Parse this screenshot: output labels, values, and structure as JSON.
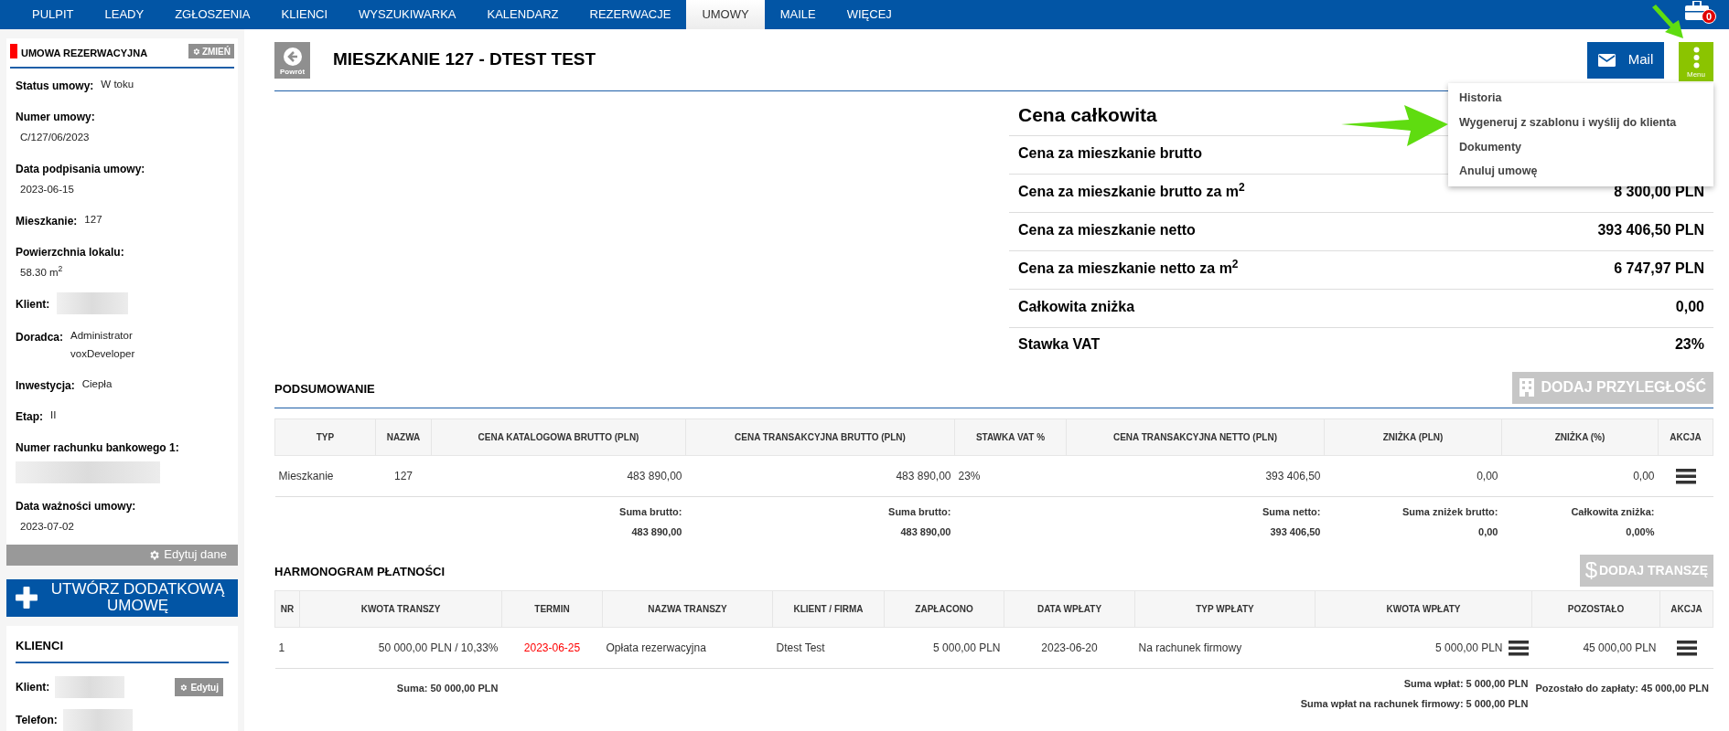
{
  "nav": {
    "items": [
      {
        "label": "PULPIT",
        "selected": false
      },
      {
        "label": "LEADY",
        "selected": false
      },
      {
        "label": "ZGŁOSZENIA",
        "selected": false
      },
      {
        "label": "KLIENCI",
        "selected": false
      },
      {
        "label": "WYSZUKIWARKA",
        "selected": false
      },
      {
        "label": "KALENDARZ",
        "selected": false
      },
      {
        "label": "REZERWACJE",
        "selected": false
      },
      {
        "label": "UMOWY",
        "selected": true
      },
      {
        "label": "MAILE",
        "selected": false
      },
      {
        "label": "WIĘCEJ",
        "selected": false
      }
    ],
    "badge": "0"
  },
  "sidebar": {
    "contract": {
      "title": "UMOWA REZERWACYJNA",
      "change_button": "ZMIEŃ",
      "fields": [
        {
          "kind": "inline",
          "label": "Status umowy:",
          "value": "W toku"
        },
        {
          "kind": "stacked",
          "label": "Numer umowy:",
          "value": "C/127/06/2023"
        },
        {
          "kind": "stacked",
          "label": "Data podpisania umowy:",
          "value": "2023-06-15"
        },
        {
          "kind": "inline",
          "label": "Mieszkanie:",
          "value": "127"
        },
        {
          "kind": "stacked",
          "label": "Powierzchnia lokalu:",
          "value": "58.30 m$^{2}$"
        },
        {
          "kind": "inline",
          "label": "Klient:",
          "redacted": true
        },
        {
          "kind": "inline",
          "label": "Doradca:",
          "value": "Administrator\nvoxDeveloper"
        },
        {
          "kind": "inline",
          "label": "Inwestycja:",
          "value": "Ciepła"
        },
        {
          "kind": "inline",
          "label": "Etap:",
          "value": "II"
        },
        {
          "kind": "stacked",
          "label": "Numer rachunku bankowego 1:",
          "redacted": true
        },
        {
          "kind": "stacked",
          "label": "Data ważności umowy:",
          "value": "2023-07-02"
        }
      ],
      "edit_button": "Edytuj dane"
    },
    "create_button": "UTWÓRZ DODATKOWĄ UMOWĘ",
    "clients": {
      "title": "KLIENCI",
      "edit_button": "Edytuj",
      "fields": [
        {
          "label": "Klient:",
          "redacted": true
        },
        {
          "label": "Telefon:",
          "redacted": true
        }
      ]
    }
  },
  "header": {
    "back_button": "Powrót",
    "title": "MIESZKANIE 127 - DTEST TEST",
    "mail_button": "Mail",
    "menu_button": "Menu",
    "menu_items": [
      "Historia",
      "Wygeneruj z szablonu i wyślij do klienta",
      "Dokumenty",
      "Anuluj umowę"
    ]
  },
  "price": {
    "title": "Cena całkowita",
    "rows": [
      {
        "label": "Cena za mieszkanie brutto"
      },
      {
        "label": "Cena za mieszkanie brutto za m$^{2}$",
        "value": "8 300,00 PLN"
      },
      {
        "label": "Cena za mieszkanie netto",
        "value": "393 406,50 PLN"
      },
      {
        "label": "Cena za mieszkanie netto za m$^{2}$",
        "value": "6 747,97 PLN"
      },
      {
        "label": "Całkowita zniżka",
        "value": "0,00"
      },
      {
        "label": "Stawka VAT",
        "value": "23%"
      }
    ]
  },
  "summary": {
    "title": "PODSUMOWANIE",
    "add_button": "DODAJ PRZYLEGŁOŚĆ",
    "columns": [
      "TYP",
      "NAZWA",
      "CENA KATALOGOWA BRUTTO (PLN)",
      "CENA TRANSAKCYJNA BRUTTO (PLN)",
      "STAWKA VAT %",
      "CENA TRANSAKCYJNA NETTO (PLN)",
      "ZNIŻKA (PLN)",
      "ZNIŻKA (%)",
      "AKCJA"
    ],
    "rows": [
      [
        "Mieszkanie",
        "127",
        "483 890,00",
        "483 890,00",
        "23%",
        "393 406,50",
        "0,00",
        "0,00"
      ]
    ],
    "totals": [
      {
        "label": "Suma brutto:",
        "value": "483 890,00"
      },
      {
        "label": "Suma brutto:",
        "value": "483 890,00"
      },
      {
        "label": "Suma netto:",
        "value": "393 406,50"
      },
      {
        "label": "Suma zniżek brutto:",
        "value": "0,00"
      },
      {
        "label": "Całkowita zniżka:",
        "value": "0,00%"
      }
    ]
  },
  "schedule": {
    "title": "HARMONOGRAM PŁATNOŚCI",
    "add_button": "DODAJ TRANSZĘ",
    "add_button_icon": "$",
    "columns": [
      "NR",
      "KWOTA TRANSZY",
      "TERMIN",
      "NAZWA TRANSZY",
      "KLIENT / FIRMA",
      "ZAPŁACONO",
      "DATA WPŁATY",
      "TYP WPŁATY",
      "KWOTA WPŁATY",
      "POZOSTAŁO",
      "AKCJA"
    ],
    "rows": [
      {
        "nr": "1",
        "amount": "50 000,00 PLN / 10,33%",
        "due": "2023-06-25",
        "overdue": true,
        "name": "Opłata rezerwacyjna",
        "client": "Dtest Test",
        "paid": "5 000,00 PLN",
        "paid_date": "2023-06-20",
        "payment_type": "Na rachunek firmowy",
        "payment_amount": "5 000,00 PLN",
        "remaining": "45 000,00 PLN"
      }
    ],
    "sum": "Suma: 50 000,00 PLN",
    "payment_sums": [
      "Suma wpłat: 5 000,00 PLN",
      "Suma wpłat na rachunek firmowy: 5 000,00 PLN"
    ],
    "remaining_sum": "Pozostało do zapłaty: 45 000,00 PLN"
  }
}
